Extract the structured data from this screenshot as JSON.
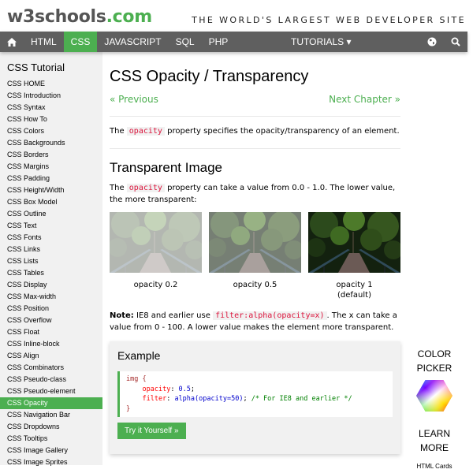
{
  "header": {
    "logo_main": "w3schools",
    "logo_suffix": ".com",
    "tagline": "THE WORLD'S LARGEST WEB DEVELOPER SITE"
  },
  "nav": {
    "home_icon": "home-icon",
    "items": [
      {
        "label": "HTML",
        "active": false
      },
      {
        "label": "CSS",
        "active": true
      },
      {
        "label": "JAVASCRIPT",
        "active": false
      },
      {
        "label": "SQL",
        "active": false
      },
      {
        "label": "PHP",
        "active": false
      }
    ],
    "tutorials_label": "TUTORIALS ▾",
    "globe_icon": "globe-icon",
    "search_icon": "search-icon"
  },
  "sidebar": {
    "title": "CSS Tutorial",
    "items": [
      {
        "label": "CSS HOME"
      },
      {
        "label": "CSS Introduction"
      },
      {
        "label": "CSS Syntax"
      },
      {
        "label": "CSS How To"
      },
      {
        "label": "CSS Colors"
      },
      {
        "label": "CSS Backgrounds"
      },
      {
        "label": "CSS Borders"
      },
      {
        "label": "CSS Margins"
      },
      {
        "label": "CSS Padding"
      },
      {
        "label": "CSS Height/Width"
      },
      {
        "label": "CSS Box Model"
      },
      {
        "label": "CSS Outline"
      },
      {
        "label": "CSS Text"
      },
      {
        "label": "CSS Fonts"
      },
      {
        "label": "CSS Links"
      },
      {
        "label": "CSS Lists"
      },
      {
        "label": "CSS Tables"
      },
      {
        "label": "CSS Display"
      },
      {
        "label": "CSS Max-width"
      },
      {
        "label": "CSS Position"
      },
      {
        "label": "CSS Overflow"
      },
      {
        "label": "CSS Float"
      },
      {
        "label": "CSS Inline-block"
      },
      {
        "label": "CSS Align"
      },
      {
        "label": "CSS Combinators"
      },
      {
        "label": "CSS Pseudo-class"
      },
      {
        "label": "CSS Pseudo-element"
      },
      {
        "label": "CSS Opacity",
        "active": true
      },
      {
        "label": "CSS Navigation Bar"
      },
      {
        "label": "CSS Dropdowns"
      },
      {
        "label": "CSS Tooltips"
      },
      {
        "label": "CSS Image Gallery"
      },
      {
        "label": "CSS Image Sprites"
      }
    ]
  },
  "main": {
    "title": "CSS Opacity / Transparency",
    "prev_label": "« Previous",
    "next_label": "Next Chapter »",
    "intro": {
      "before": "The ",
      "code": "opacity",
      "after": " property specifies the opacity/transparency of an element."
    },
    "section_title": "Transparent Image",
    "section_text": {
      "before": "The ",
      "code": "opacity",
      "after": " property can take a value from 0.0 - 1.0. The lower value, the more transparent:"
    },
    "images": [
      {
        "caption": "opacity 0.2",
        "caption2": "",
        "opacity": 0.2
      },
      {
        "caption": "opacity 0.5",
        "caption2": "",
        "opacity": 0.5
      },
      {
        "caption": "opacity 1",
        "caption2": "(default)",
        "opacity": 1
      }
    ],
    "note": {
      "label": "Note:",
      "before": " IE8 and earlier use ",
      "code": "filter:alpha(opacity=x)",
      "after": ". The x can take a value from 0 - 100. A lower value makes the element more transparent."
    },
    "example": {
      "title": "Example",
      "code": {
        "selector": "img",
        "open": " {",
        "prop1": "opacity",
        "val1": " 0.5",
        "prop2": "filter",
        "val2": " alpha(opacity=50)",
        "comment": "/* For IE8 and earlier */",
        "close": "}"
      },
      "button_label": "Try it Yourself »"
    }
  },
  "right": {
    "color_picker_line1": "COLOR",
    "color_picker_line2": "PICKER",
    "learn_line1": "LEARN",
    "learn_line2": "MORE",
    "cards_label": "HTML Cards"
  },
  "colors": {
    "brand_green": "#4CAF50",
    "nav_bg": "#5f5f5f",
    "sidebar_bg": "#f1f1f1",
    "code_red": "#dc143c"
  }
}
